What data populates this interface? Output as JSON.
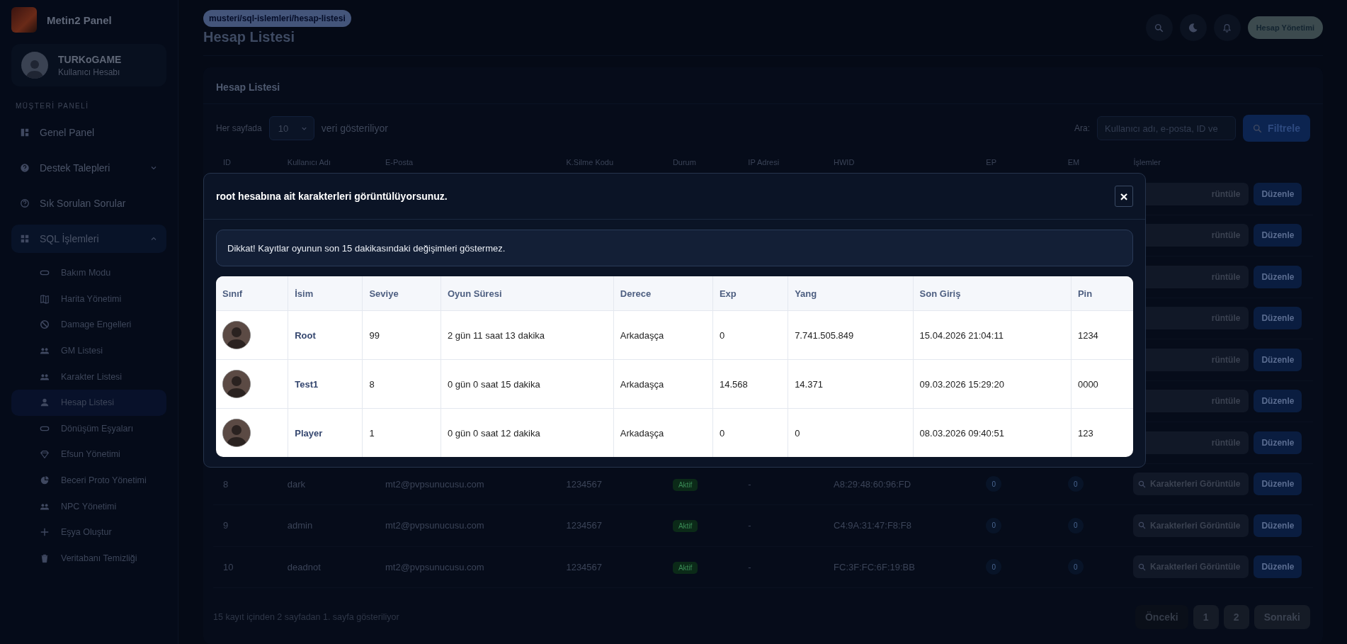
{
  "sidebar": {
    "brand": "Metin2 Panel",
    "user": {
      "name": "TURKoGAME",
      "role": "Kullanıcı Hesabı"
    },
    "section": "MÜŞTERİ PANELİ",
    "items": [
      {
        "label": "Genel Panel",
        "kind": "item",
        "selected": false
      },
      {
        "label": "Destek Talepleri",
        "kind": "group",
        "expanded": false
      },
      {
        "label": "Sık Sorulan Sorular",
        "kind": "item",
        "selected": false
      },
      {
        "label": "SQL İşlemleri",
        "kind": "group",
        "expanded": true,
        "children": [
          {
            "label": "Bakım Modu",
            "selected": false
          },
          {
            "label": "Harita Yönetimi",
            "selected": false
          },
          {
            "label": "Damage Engelleri",
            "selected": false
          },
          {
            "label": "GM Listesi",
            "selected": false
          },
          {
            "label": "Karakter Listesi",
            "selected": false
          },
          {
            "label": "Hesap Listesi",
            "selected": true
          },
          {
            "label": "Dönüşüm Eşyaları",
            "selected": false
          },
          {
            "label": "Efsun Yönetimi",
            "selected": false
          },
          {
            "label": "Beceri Proto Yönetimi",
            "selected": false
          },
          {
            "label": "NPC Yönetimi",
            "selected": false
          },
          {
            "label": "Eşya Oluştur",
            "selected": false
          },
          {
            "label": "Veritabanı Temizliği",
            "selected": false
          }
        ]
      }
    ]
  },
  "header": {
    "breadcrumb": "musteri/sql-islemleri/hesap-listesi",
    "title": "Hesap Listesi",
    "account_button": "Hesap Yönetimi"
  },
  "card": {
    "title": "Hesap Listesi",
    "per_page_label": "Her sayfada",
    "per_page_value": "10",
    "per_page_suffix": "veri gösteriliyor",
    "search_label": "Ara:",
    "search_placeholder": "Kullanıcı adı, e-posta, ID ve",
    "filter_button": "Filtrele",
    "columns": [
      "ID",
      "Kullanıcı Adı",
      "E-Posta",
      "K.Silme Kodu",
      "Durum",
      "IP Adresi",
      "HWID",
      "EP",
      "EM",
      "İşlemler"
    ],
    "rows": [
      {
        "kind": "covered",
        "view_button": "rüntüle",
        "edit_button": "Düzenle"
      },
      {
        "kind": "covered",
        "view_button": "rüntüle",
        "edit_button": "Düzenle"
      },
      {
        "kind": "covered",
        "view_button": "rüntüle",
        "edit_button": "Düzenle"
      },
      {
        "kind": "covered",
        "view_button": "rüntüle",
        "edit_button": "Düzenle"
      },
      {
        "kind": "covered",
        "view_button": "rüntüle",
        "edit_button": "Düzenle"
      },
      {
        "kind": "covered",
        "view_button": "rüntüle",
        "edit_button": "Düzenle"
      },
      {
        "kind": "covered",
        "view_button": "rüntüle",
        "edit_button": "Düzenle"
      },
      {
        "kind": "full",
        "id": "8",
        "username": "dark",
        "email": "mt2@pvpsunucusu.com",
        "code": "1234567",
        "status": "Aktif",
        "ip": "-",
        "hwid": "A8:29:48:60:96:FD",
        "ep": "0",
        "em": "0",
        "view_button": "Karakterleri Görüntüle",
        "edit_button": "Düzenle"
      },
      {
        "kind": "full",
        "id": "9",
        "username": "admin",
        "email": "mt2@pvpsunucusu.com",
        "code": "1234567",
        "status": "Aktif",
        "ip": "-",
        "hwid": "C4:9A:31:47:F8:F8",
        "ep": "0",
        "em": "0",
        "view_button": "Karakterleri Görüntüle",
        "edit_button": "Düzenle"
      },
      {
        "kind": "full",
        "id": "10",
        "username": "deadnot",
        "email": "mt2@pvpsunucusu.com",
        "code": "1234567",
        "status": "Aktif",
        "ip": "-",
        "hwid": "FC:3F:FC:6F:19:BB",
        "ep": "0",
        "em": "0",
        "view_button": "Karakterleri Görüntüle",
        "edit_button": "Düzenle"
      }
    ],
    "footer": "15 kayıt içinden 2 sayfadan 1. sayfa gösteriliyor",
    "pagination": [
      {
        "label": "Önceki",
        "disabled": true
      },
      {
        "label": "1",
        "disabled": false
      },
      {
        "label": "2",
        "disabled": false
      },
      {
        "label": "Sonraki",
        "disabled": false
      }
    ]
  },
  "modal": {
    "title": "root hesabına ait karakterleri görüntülüyorsunuz.",
    "close": "×",
    "alert": "Dikkat! Kayıtlar oyunun son 15 dakikasındaki değişimleri göstermez.",
    "columns": [
      "Sınıf",
      "İsim",
      "Seviye",
      "Oyun Süresi",
      "Derece",
      "Exp",
      "Yang",
      "Son Giriş",
      "Pin"
    ],
    "rows": [
      {
        "name": "Root",
        "level": "99",
        "playtime": "2 gün 11 saat 13 dakika",
        "rank": "Arkadaşça",
        "exp": "0",
        "yang": "7.741.505.849",
        "last_login": "15.04.2026 21:04:11",
        "pin": "1234"
      },
      {
        "name": "Test1",
        "level": "8",
        "playtime": "0 gün 0 saat 15 dakika",
        "rank": "Arkadaşça",
        "exp": "14.568",
        "yang": "14.371",
        "last_login": "09.03.2026 15:29:20",
        "pin": "0000"
      },
      {
        "name": "Player",
        "level": "1",
        "playtime": "0 gün 0 saat 12 dakika",
        "rank": "Arkadaşça",
        "exp": "0",
        "yang": "0",
        "last_login": "08.03.2026 09:40:51",
        "pin": "123"
      }
    ]
  }
}
